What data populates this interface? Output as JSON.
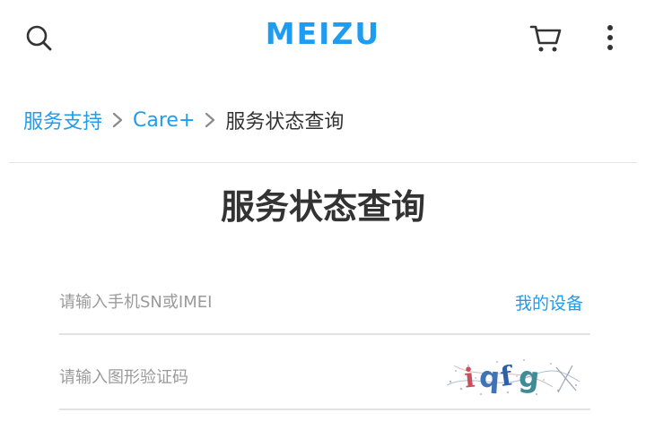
{
  "header": {
    "logo_text": "MEIZU",
    "icons": {
      "search": "search-icon",
      "cart": "cart-icon",
      "more": "more-vertical-icon"
    },
    "brand_color": "#1e9cf0"
  },
  "breadcrumb": {
    "items": [
      "服务支持",
      "Care+",
      "服务状态查询"
    ]
  },
  "page": {
    "title": "服务状态查询"
  },
  "form": {
    "sn_field": {
      "placeholder": "请输入手机SN或IMEI",
      "value": ""
    },
    "my_device_link": "我的设备",
    "captcha_field": {
      "placeholder": "请输入图形验证码",
      "value": ""
    },
    "captcha_text": "iqfg"
  }
}
